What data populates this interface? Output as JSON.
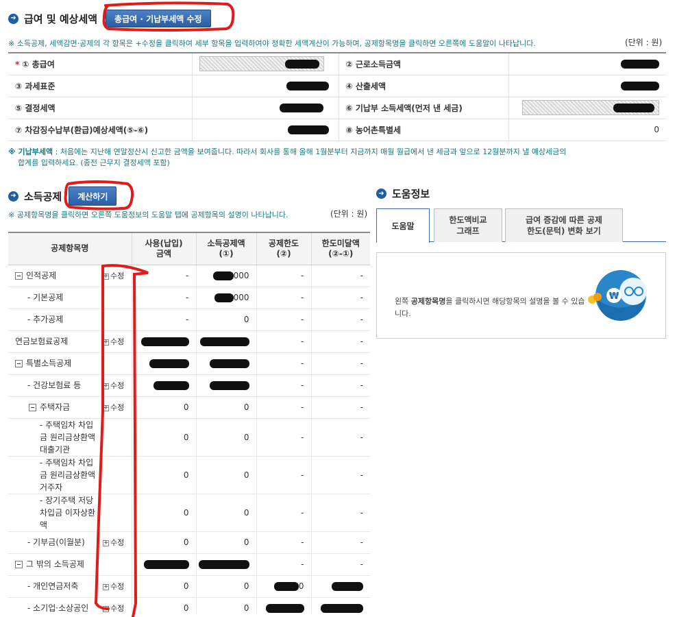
{
  "section1": {
    "title": "급여 및 예상세액",
    "edit_button": "총급여 · 기납부세액 수정",
    "note": "※ 소득공제, 세액감면·공제의 각 항목은 +수정을 클릭하여 세부 항목을 입력하여야 정확한 세액계산이 가능하며, 공제항목명을 클릭하면 오른쪽에 도움말이 나타납니다.",
    "unit": "(단위 : 원)"
  },
  "summary": {
    "total_salary": "① 총급여",
    "earned_income": "② 근로소득금액",
    "tax_base": "③ 과세표준",
    "computed_tax": "④ 산출세액",
    "determined_tax": "⑤ 결정세액",
    "prepaid_tax": "⑥ 기납부 소득세액(먼저 낸 세금)",
    "expected_tax": "⑦ 차감징수납부(환급)예상세액(⑤-⑥)",
    "rural_tax": "⑧ 농어촌특별세",
    "rural_tax_value": "0"
  },
  "note2": {
    "bold": "※ 기납부세액",
    "line1": " : 처음에는 지난해 연말정산시 신고한 금액을 보여줍니다. 따라서 회사를 통해 올해 1월분부터 지금까지 매월 월급에서 낸 세금과 앞으로 12월분까지 낼 예상세금의",
    "line2": "합계를 입력하세요. (종전 근무지 결정세액 포함)"
  },
  "section2": {
    "title": "소득공제",
    "calc_button": "계산하기",
    "note": "※ 공제항목명을 클릭하면 오른쪽 도움정보의 도움말 탭에 공제항목의 설명이 나타납니다.",
    "unit": "(단위 : 원)"
  },
  "table": {
    "headers": {
      "item": "공제항목명",
      "used_1": "사용(납입)",
      "used_2": "금액",
      "ded_1": "소득공제액",
      "ded_2": "(①)",
      "limit_1": "공제한도",
      "limit_2": "(②)",
      "remain_1": "한도미달액",
      "remain_2": "(②-①)"
    },
    "edit_label": "수정",
    "dash": "-",
    "zero": "0",
    "rows": {
      "personal": "인적공제",
      "personal_amt_tail": "000",
      "basic": "- 기본공제",
      "basic_amt_tail": "000",
      "additional": "- 추가공제",
      "pension": "연금보험료공제",
      "special": "특별소득공제",
      "health": "- 건강보험료 등",
      "housing": "주택자금",
      "housing1": "- 주택임차 차입금 원리금상환액 대출기관",
      "housing2": "- 주택임차 차입금 원리금상환액 거주자",
      "housing3": "- 장기주택 저당차입금 이자상환액",
      "donation": "- 기부금(이월분)",
      "other": "그 밖의 소득공제",
      "personal_pension": "- 개인연금저축",
      "personal_pension_tail": "0",
      "small_biz": "- 소기업·소상공인"
    }
  },
  "help": {
    "title": "도움정보",
    "tab1": "도움말",
    "tab2_1": "한도액비교",
    "tab2_2": "그래프",
    "tab3_1": "급여 증감에 따른 공제",
    "tab3_2": "한도(문턱) 변화 보기",
    "message_pre": "왼쪽 ",
    "message_bold": "공제항목명",
    "message_post": "을 클릭하시면 해당항목의 설명을 볼 수 있습니다.",
    "mascot_symbol": "₩"
  }
}
